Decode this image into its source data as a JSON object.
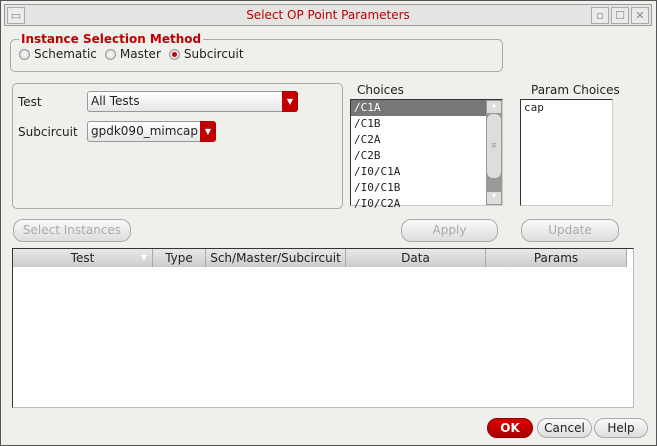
{
  "window": {
    "title": "Select OP Point Parameters",
    "buttons": [
      "minimize",
      "maximize",
      "close"
    ]
  },
  "instance_selection": {
    "legend": "Instance Selection Method",
    "options": [
      {
        "label": "Schematic",
        "selected": false
      },
      {
        "label": "Master",
        "selected": false
      },
      {
        "label": "Subcircuit",
        "selected": true
      }
    ]
  },
  "filters": {
    "test_label": "Test",
    "test_value": "All Tests",
    "subcircuit_label": "Subcircuit",
    "subcircuit_value": "gpdk090_mimcap"
  },
  "choices": {
    "label": "Choices",
    "items": [
      "/C1A",
      "/C1B",
      "/C2A",
      "/C2B",
      "/I0/C1A",
      "/I0/C1B",
      "/I0/C2A"
    ],
    "selected": "/C1A"
  },
  "param_choices": {
    "label": "Param Choices",
    "items": [
      "cap"
    ]
  },
  "buttons": {
    "select_instances": "Select Instances",
    "apply": "Apply",
    "update": "Update",
    "ok": "OK",
    "cancel": "Cancel",
    "help": "Help"
  },
  "table": {
    "columns": [
      "Test",
      "Type",
      "Sch/Master/Subcircuit",
      "Data",
      "Params"
    ],
    "rows": []
  },
  "colors": {
    "accent": "#c00000"
  }
}
